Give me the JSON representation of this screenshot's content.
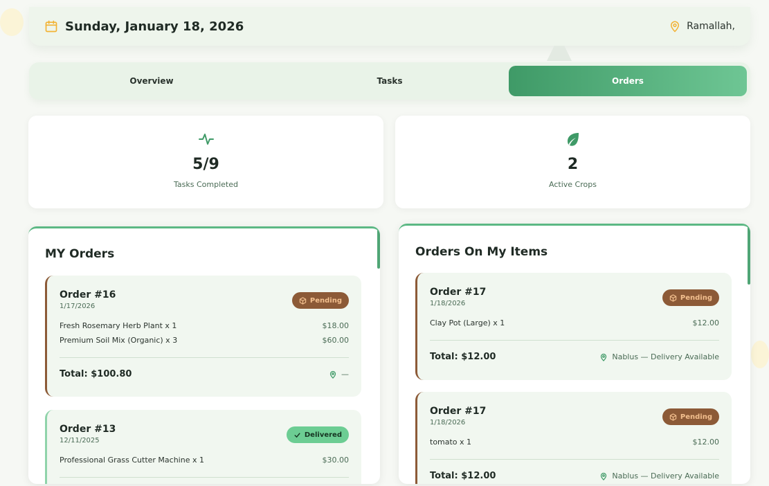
{
  "header": {
    "date": "Sunday, January 18, 2026",
    "location": "Ramallah,"
  },
  "tabs": [
    {
      "label": "Overview",
      "active": false
    },
    {
      "label": "Tasks",
      "active": false
    },
    {
      "label": "Orders",
      "active": true
    }
  ],
  "stats": [
    {
      "icon": "activity-icon",
      "value": "5/9",
      "label": "Tasks Completed"
    },
    {
      "icon": "leaf-icon",
      "value": "2",
      "label": "Active Crops"
    }
  ],
  "my_orders": {
    "title": "MY Orders",
    "orders": [
      {
        "id": "Order #16",
        "date": "1/17/2026",
        "status": "Pending",
        "items": [
          {
            "name": "Fresh Rosemary Herb Plant x 1",
            "price": "$18.00"
          },
          {
            "name": "Premium Soil Mix (Organic) x 3",
            "price": "$60.00"
          }
        ],
        "total": "Total: $100.80",
        "delivery": "—"
      },
      {
        "id": "Order #13",
        "date": "12/11/2025",
        "status": "Delivered",
        "items": [
          {
            "name": "Professional Grass Cutter Machine x 1",
            "price": "$30.00"
          }
        ]
      }
    ]
  },
  "orders_on_items": {
    "title": "Orders On My Items",
    "orders": [
      {
        "id": "Order #17",
        "date": "1/18/2026",
        "status": "Pending",
        "items": [
          {
            "name": "Clay Pot (Large) x 1",
            "price": "$12.00"
          }
        ],
        "total": "Total: $12.00",
        "delivery": "Nablus — Delivery Available"
      },
      {
        "id": "Order #17",
        "date": "1/18/2026",
        "status": "Pending",
        "items": [
          {
            "name": "tomato x 1",
            "price": "$12.00"
          }
        ],
        "total": "Total: $12.00",
        "delivery": "Nablus — Delivery Available"
      }
    ]
  },
  "colors": {
    "accent_green": "#3f9a67",
    "pending_brown": "#8c5a37",
    "delivered_green": "#6ccd93",
    "calendar_yellow": "#f2b233"
  }
}
